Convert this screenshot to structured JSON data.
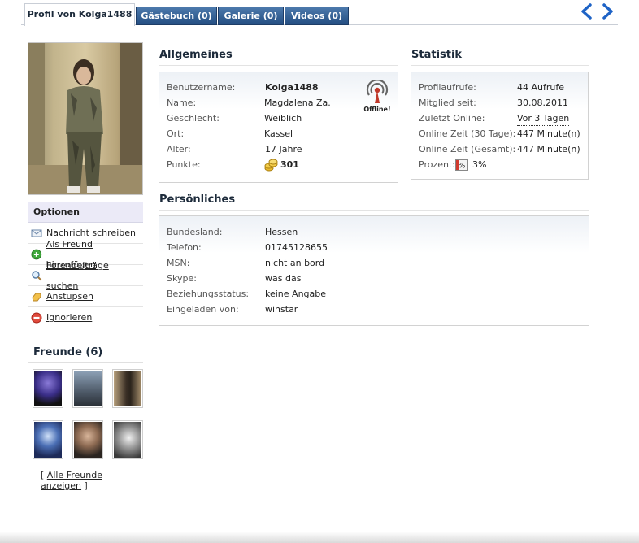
{
  "tabs": [
    {
      "label": "Profil von Kolga1488",
      "active": true
    },
    {
      "label": "Gästebuch (0)",
      "active": false
    },
    {
      "label": "Galerie (0)",
      "active": false
    },
    {
      "label": "Videos (0)",
      "active": false
    }
  ],
  "nav": {
    "prev_icon": "arrow-left-icon",
    "next_icon": "arrow-right-icon"
  },
  "colors": {
    "tab_dark": "#2f5d93",
    "accent_blue": "#1e63c6",
    "panel_border": "#d2d2d2"
  },
  "options": {
    "title": "Optionen",
    "items": [
      {
        "label": "Nachricht schreiben",
        "icon": "envelope-icon"
      },
      {
        "label": "Als Freund hinzufügen",
        "icon": "add-green-icon"
      },
      {
        "label": "Forenbeiträge suchen",
        "icon": "magnifier-icon"
      },
      {
        "label": "Anstupsen",
        "icon": "poke-hand-icon"
      },
      {
        "label": "Ignorieren",
        "icon": "block-red-icon"
      }
    ]
  },
  "friends": {
    "title": "Freunde (6)",
    "all_label": "Alle Freunde anzeigen",
    "bracket_open": "[",
    "bracket_close": "]"
  },
  "allgemeines": {
    "title": "Allgemeines",
    "status": "Offline!",
    "rows": [
      {
        "label": "Benutzername:",
        "value": "Kolga1488"
      },
      {
        "label": "Name:",
        "value": "Magdalena Za."
      },
      {
        "label": "Geschlecht:",
        "value": "Weiblich"
      },
      {
        "label": "Ort:",
        "value": "Kassel"
      },
      {
        "label": "Alter:",
        "value": "17 Jahre"
      },
      {
        "label": "Punkte:",
        "value": "301"
      }
    ]
  },
  "statistik": {
    "title": "Statistik",
    "rows": [
      {
        "label": "Profilaufrufe:",
        "value": "44 Aufrufe"
      },
      {
        "label": "Mitglied seit:",
        "value": "30.08.2011"
      },
      {
        "label": "Zuletzt Online:",
        "value": "Vor 3 Tagen"
      },
      {
        "label": "Online Zeit (30 Tage):",
        "value": "447 Minute(n)"
      },
      {
        "label": "Online Zeit (Gesamt):",
        "value": "447 Minute(n)"
      }
    ],
    "prozent_label": "Prozent:",
    "prozent_value": "3%",
    "prozent_level": 0.03
  },
  "persoenliches": {
    "title": "Persönliches",
    "rows": [
      {
        "label": "Bundesland:",
        "value": "Hessen"
      },
      {
        "label": "Telefon:",
        "value": "01745128655"
      },
      {
        "label": "MSN:",
        "value": "nicht an bord"
      },
      {
        "label": "Skype:",
        "value": "was das"
      },
      {
        "label": "Beziehungsstatus:",
        "value": "keine Angabe"
      },
      {
        "label": "Eingeladen von:",
        "value": "winstar"
      }
    ]
  }
}
